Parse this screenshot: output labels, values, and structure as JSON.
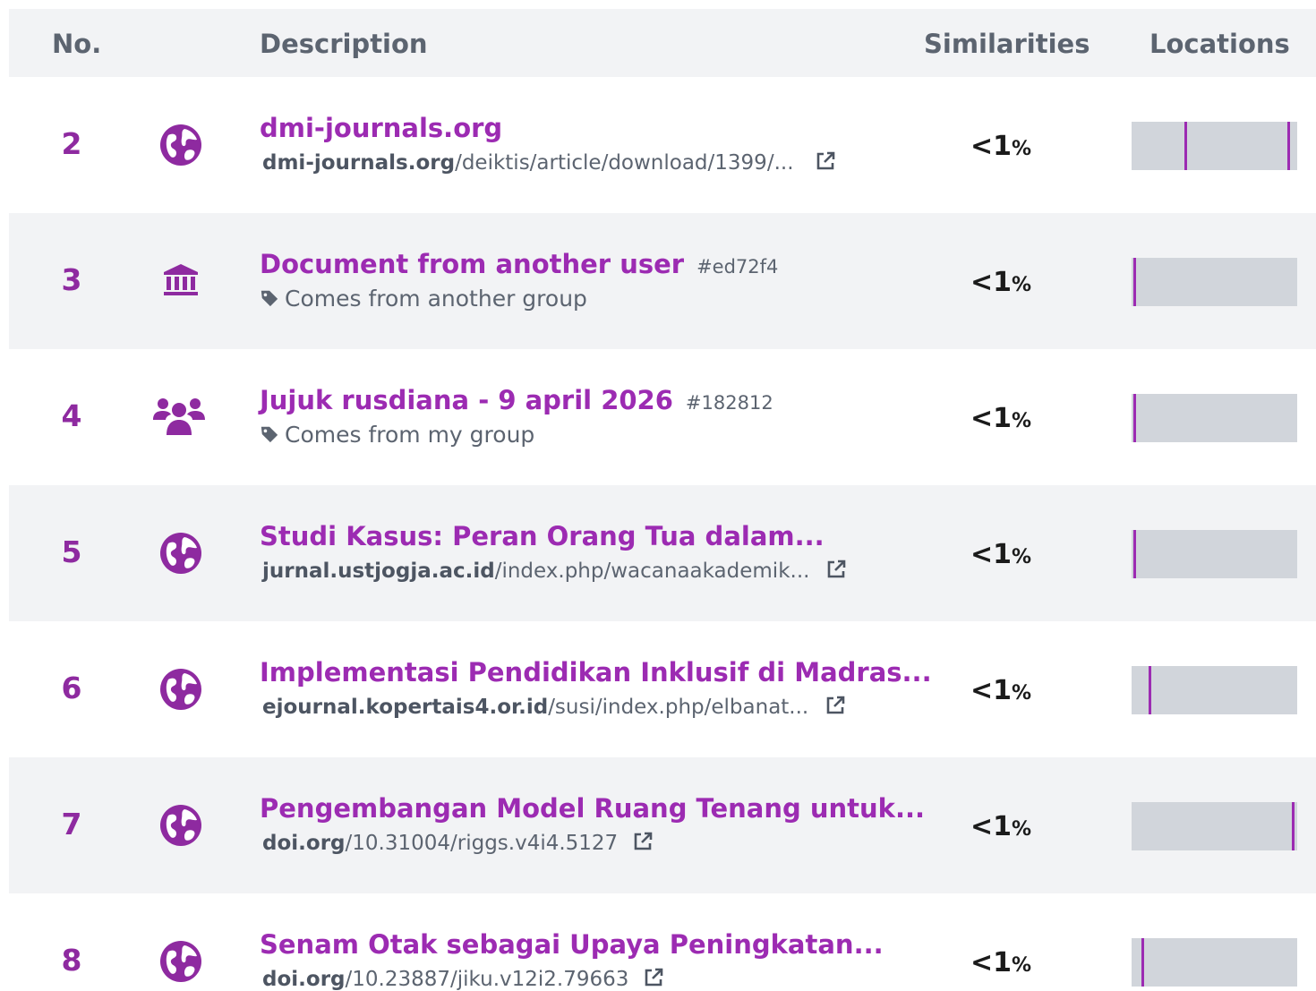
{
  "header": {
    "no": "No.",
    "description": "Description",
    "similarities": "Similarities",
    "locations": "Locations"
  },
  "rows": [
    {
      "no": "2",
      "icon": "globe-icon",
      "title": "dmi-journals.org",
      "url_host": "dmi-journals.org",
      "url_path": "/deiktis/article/download/1399/...",
      "similarity": "<1",
      "pct": "%",
      "location_marks": [
        0.32,
        0.94
      ]
    },
    {
      "no": "3",
      "icon": "institution-icon",
      "title": "Document from another user",
      "doc_id": "#ed72f4",
      "tag": "Comes from another group",
      "similarity": "<1",
      "pct": "%",
      "location_marks": [
        0.01
      ]
    },
    {
      "no": "4",
      "icon": "users-icon",
      "title": "Jujuk rusdiana - 9 april 2026",
      "doc_id": "#182812",
      "tag": "Comes from my group",
      "similarity": "<1",
      "pct": "%",
      "location_marks": [
        0.01
      ]
    },
    {
      "no": "5",
      "icon": "globe-icon",
      "title": "Studi Kasus: Peran Orang Tua dalam...",
      "url_host": "jurnal.ustjogja.ac.id",
      "url_path": "/index.php/wacanaakademik...",
      "similarity": "<1",
      "pct": "%",
      "location_marks": [
        0.01
      ]
    },
    {
      "no": "6",
      "icon": "globe-icon",
      "title": "Implementasi Pendidikan Inklusif di Madras...",
      "url_host": "ejournal.kopertais4.or.id",
      "url_path": "/susi/index.php/elbanat...",
      "similarity": "<1",
      "pct": "%",
      "location_marks": [
        0.1
      ]
    },
    {
      "no": "7",
      "icon": "globe-icon",
      "title": "Pengembangan Model Ruang Tenang untuk...",
      "url_host": "doi.org",
      "url_path": "/10.31004/riggs.v4i4.5127",
      "similarity": "<1",
      "pct": "%",
      "location_marks": [
        0.97
      ]
    },
    {
      "no": "8",
      "icon": "globe-icon",
      "title": "Senam Otak sebagai Upaya Peningkatan...",
      "url_host": "doi.org",
      "url_path": "/10.23887/jiku.v12i2.79663",
      "similarity": "<1",
      "pct": "%",
      "location_marks": [
        0.06
      ]
    }
  ],
  "colors": {
    "accent": "#9c2bb2",
    "number": "#8e2aa0",
    "bar": "#d1d5db",
    "stripe": "#f2f3f5"
  }
}
